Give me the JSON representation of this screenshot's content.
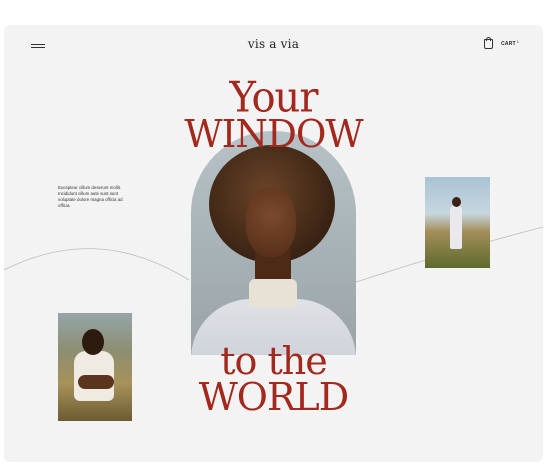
{
  "header": {
    "brand": "vis a via",
    "cart_label": "CART",
    "cart_count": "1"
  },
  "hero": {
    "line1": "Your",
    "line2": "WINDOW",
    "line3": "to the",
    "line4": "WORLD"
  },
  "blurb": "Excepteur cillum deserunt mollit. Incididunt cillum aute sunt sunt voluptate dolore magna officia ad officia.",
  "colors": {
    "accent": "#a3281d",
    "background": "#f3f3f3"
  },
  "icons": {
    "menu": "hamburger-icon",
    "cart": "shopping-bag-icon"
  }
}
